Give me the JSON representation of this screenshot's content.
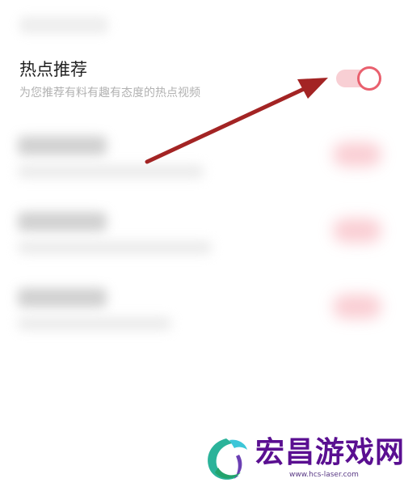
{
  "setting": {
    "title": "热点推荐",
    "description": "为您推荐有料有趣有态度的热点视频",
    "enabled": true
  },
  "colors": {
    "accent": "#e9606e",
    "track": "#f8cfd4",
    "arrow": "#a32424",
    "watermark": "#5a0f91"
  },
  "watermark": {
    "name": "宏昌游戏网",
    "url": "www.hcs-laser.com"
  },
  "icons": [
    "toggle-switch",
    "annotation-arrow-icon",
    "dragon-logo-icon"
  ]
}
